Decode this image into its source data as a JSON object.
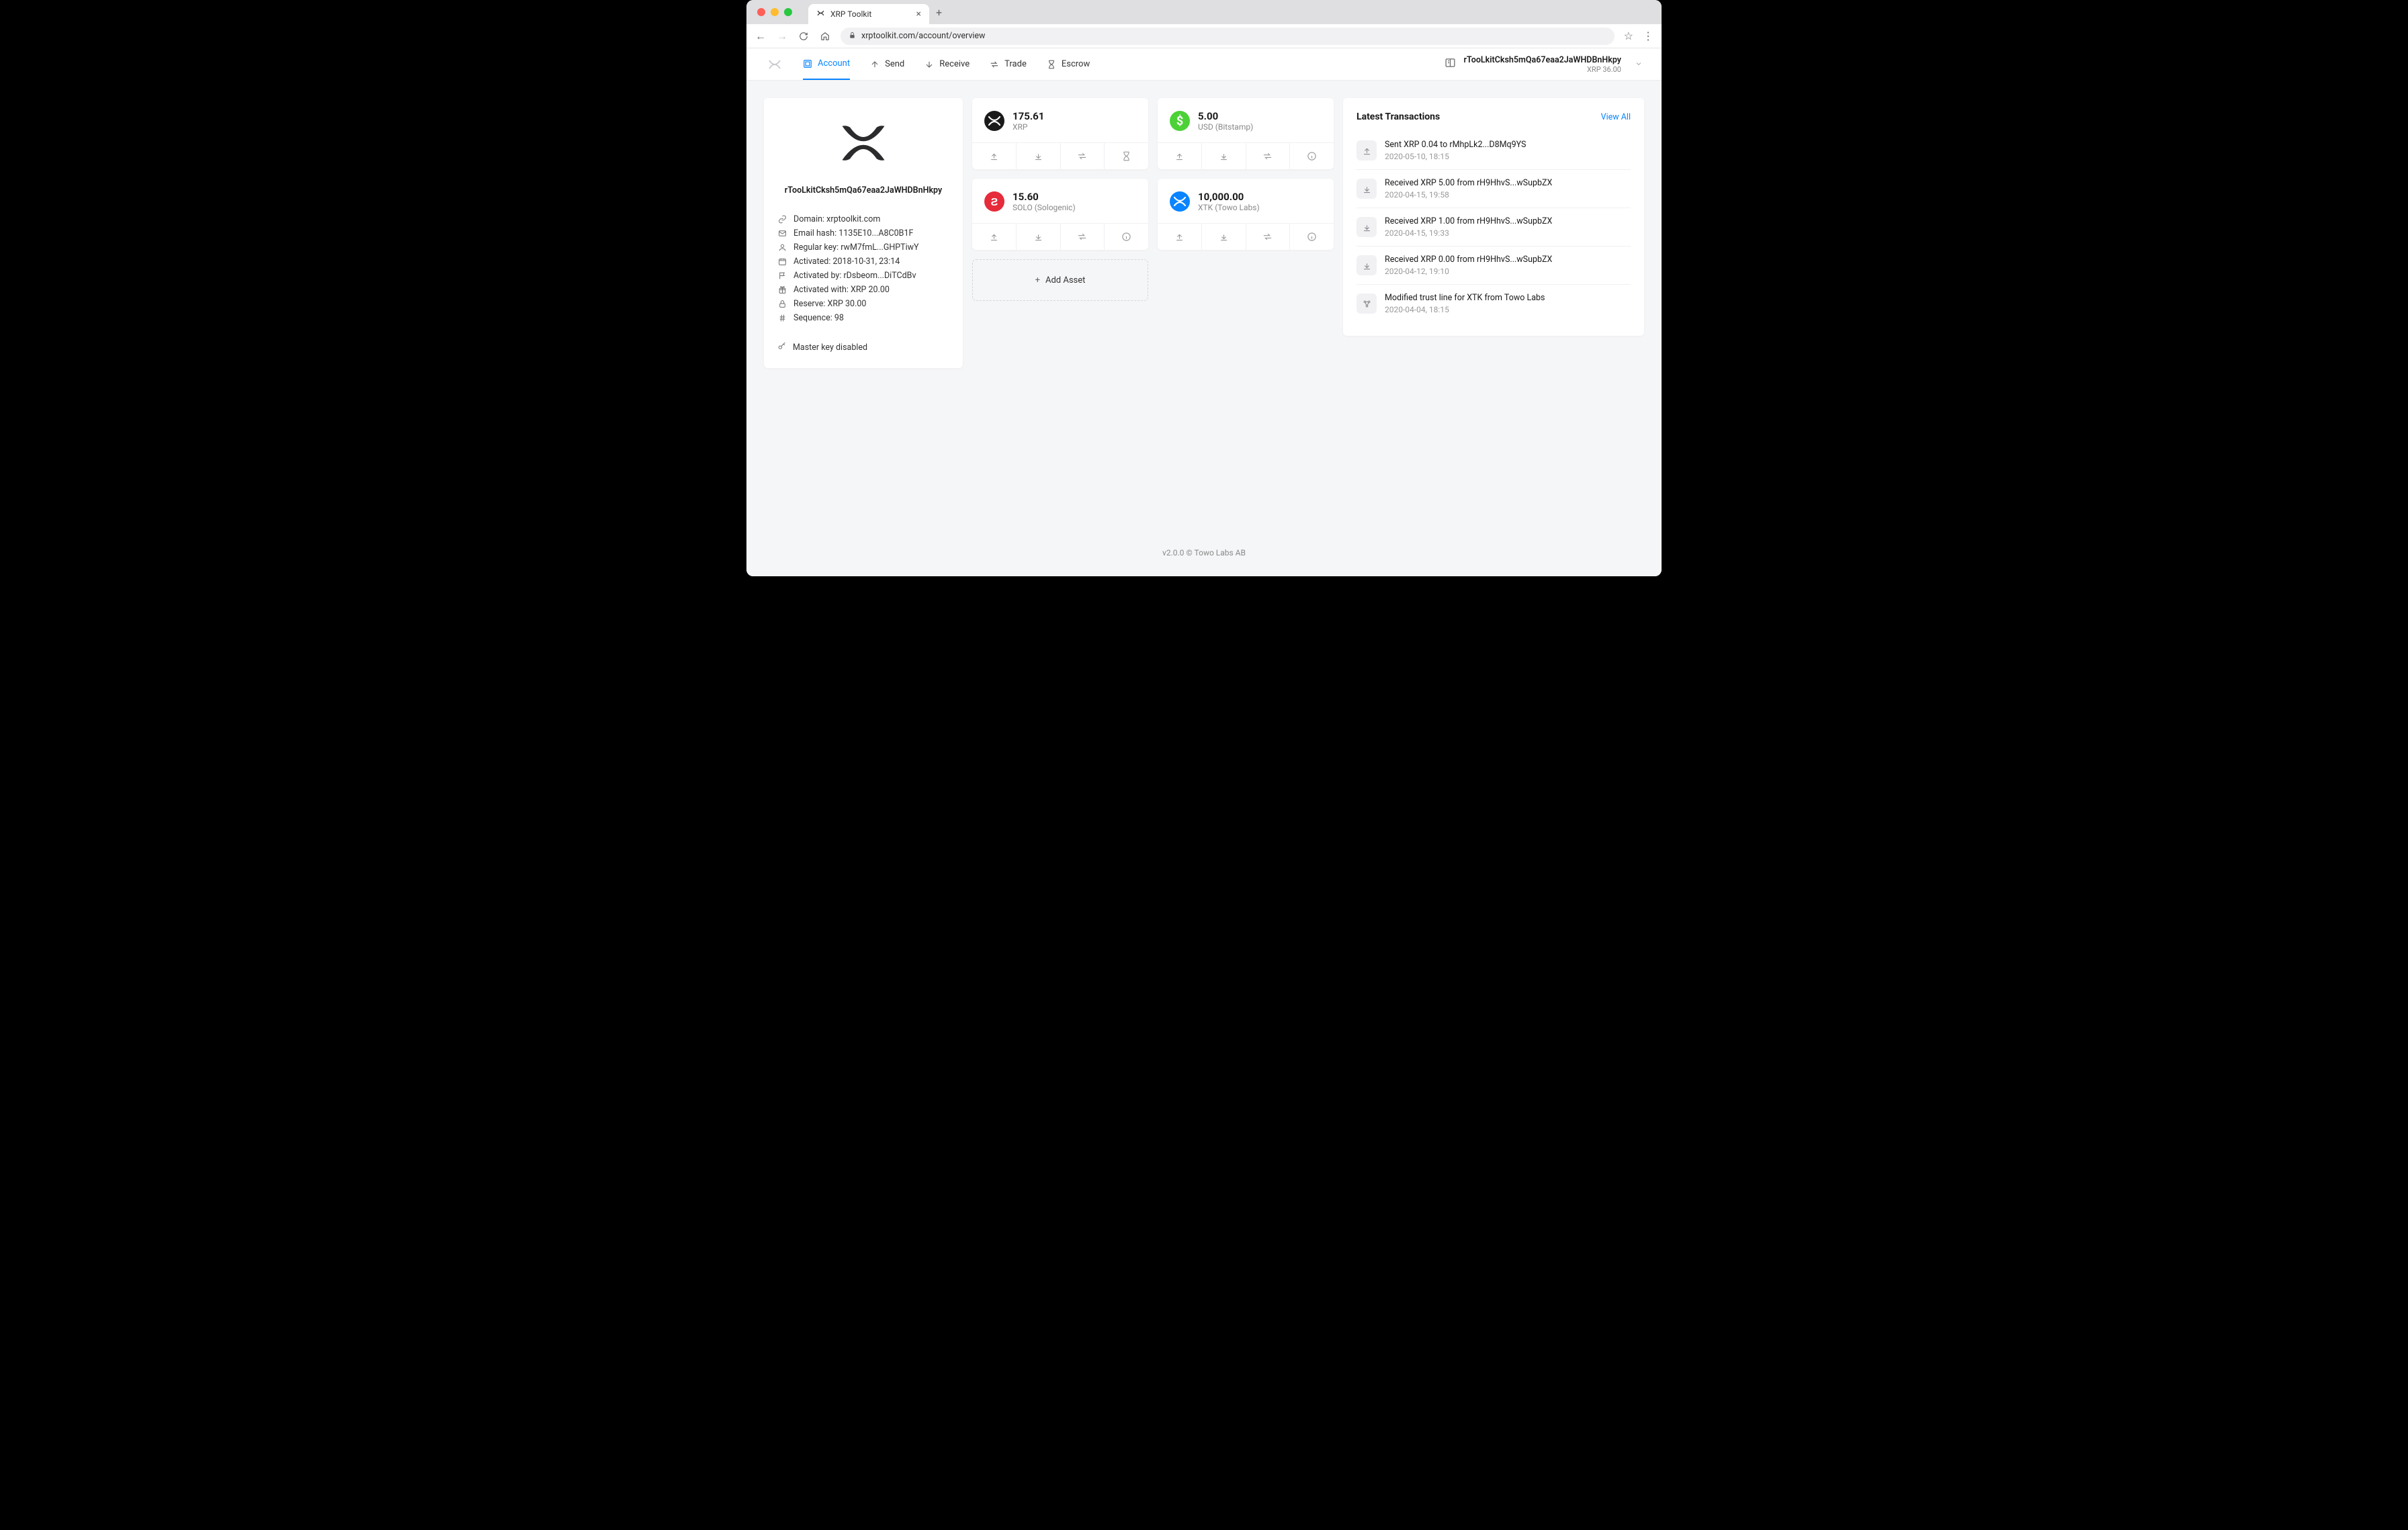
{
  "browser": {
    "tab_title": "XRP Toolkit",
    "url": "xrptoolkit.com/account/overview"
  },
  "nav": {
    "items": [
      {
        "label": "Account",
        "active": true
      },
      {
        "label": "Send",
        "active": false
      },
      {
        "label": "Receive",
        "active": false
      },
      {
        "label": "Trade",
        "active": false
      },
      {
        "label": "Escrow",
        "active": false
      }
    ]
  },
  "account_selector": {
    "address": "rTooLkitCksh5mQa67eaa2JaWHDBnHkpy",
    "balance_sub": "XRP 36.00"
  },
  "account_card": {
    "address": "rTooLkitCksh5mQa67eaa2JaWHDBnHkpy",
    "meta": [
      {
        "icon": "link",
        "label": "Domain: xrptoolkit.com"
      },
      {
        "icon": "mail",
        "label": "Email hash: 1135E10...A8C0B1F"
      },
      {
        "icon": "user",
        "label": "Regular key: rwM7fmL...GHPTiwY"
      },
      {
        "icon": "calendar",
        "label": "Activated: 2018-10-31, 23:14"
      },
      {
        "icon": "flag",
        "label": "Activated by: rDsbeom...DiTCdBv"
      },
      {
        "icon": "gift",
        "label": "Activated with: XRP 20.00"
      },
      {
        "icon": "lock",
        "label": "Reserve: XRP 30.00"
      },
      {
        "icon": "hash",
        "label": "Sequence: 98"
      }
    ],
    "master_key_label": "Master key disabled"
  },
  "assets": [
    {
      "amount": "175.61",
      "symbol": "XRP",
      "sub": "",
      "icon_bg": "#1a1a1a",
      "icon_type": "xrp",
      "actions": [
        "send",
        "receive",
        "trade",
        "escrow"
      ]
    },
    {
      "amount": "5.00",
      "symbol": "USD (Bitstamp)",
      "sub": "",
      "icon_bg": "#4cd137",
      "icon_type": "usd",
      "actions": [
        "send",
        "receive",
        "trade",
        "info"
      ]
    },
    {
      "amount": "15.60",
      "symbol": "SOLO (Sologenic)",
      "sub": "",
      "icon_bg": "#e62b3a",
      "icon_type": "solo",
      "actions": [
        "send",
        "receive",
        "trade",
        "info"
      ]
    },
    {
      "amount": "10,000.00",
      "symbol": "XTK (Towo Labs)",
      "sub": "",
      "icon_bg": "#0a84ff",
      "icon_type": "xtk",
      "actions": [
        "send",
        "receive",
        "trade",
        "info"
      ]
    }
  ],
  "add_asset_label": "Add Asset",
  "transactions": {
    "title": "Latest Transactions",
    "view_all": "View All",
    "items": [
      {
        "icon": "send",
        "text": "Sent XRP 0.04 to rMhpLk2...D8Mq9YS",
        "time": "2020-05-10, 18:15"
      },
      {
        "icon": "receive",
        "text": "Received XRP 5.00 from rH9HhvS...wSupbZX",
        "time": "2020-04-15, 19:58"
      },
      {
        "icon": "receive",
        "text": "Received XRP 1.00 from rH9HhvS...wSupbZX",
        "time": "2020-04-15, 19:33"
      },
      {
        "icon": "receive",
        "text": "Received XRP 0.00 from rH9HhvS...wSupbZX",
        "time": "2020-04-12, 19:10"
      },
      {
        "icon": "trust",
        "text": "Modified trust line for XTK from Towo Labs",
        "time": "2020-04-04, 18:15"
      }
    ]
  },
  "footer": "v2.0.0 © Towo Labs AB"
}
